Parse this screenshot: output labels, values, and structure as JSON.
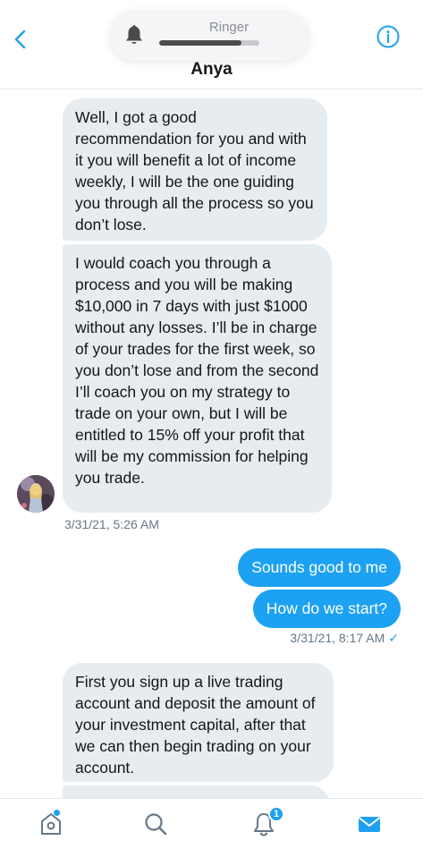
{
  "header": {
    "ringer_label": "Ringer",
    "ringer_level": 0.82,
    "contact_name": "Anya",
    "back_icon": "chevron-left-icon",
    "info_icon": "info-icon"
  },
  "messages": {
    "m1": "Well, I got a good recommendation for you and with it you will benefit a lot of income weekly, I will be the one guiding you through all the process so you don’t lose.",
    "m2": "I would coach you through a process and you will be making $10,000 in 7 days with just $1000 without any losses. I’ll be in charge of your trades for the first week, so you don’t lose and from the second I’ll coach you on my strategy to trade on your own, but I will be entitled to 15% off your profit that will be my commission for helping you trade.",
    "ts1": "3/31/21, 5:26 AM",
    "m3": "Sounds good to me",
    "m4": "How do we start?",
    "ts2": "3/31/21, 8:17 AM",
    "ts2_check": "✓",
    "m5": "First you sign up a live trading account and deposit the amount of your investment capital, after that we can then begin trading on your account."
  },
  "tabbar": {
    "notification_badge": "1",
    "icons": [
      "home-icon",
      "search-icon",
      "notifications-icon",
      "messages-icon"
    ]
  },
  "colors": {
    "accent": "#1da1f2",
    "incoming_bubble": "#e6ecf0",
    "timestamp": "#657786"
  }
}
